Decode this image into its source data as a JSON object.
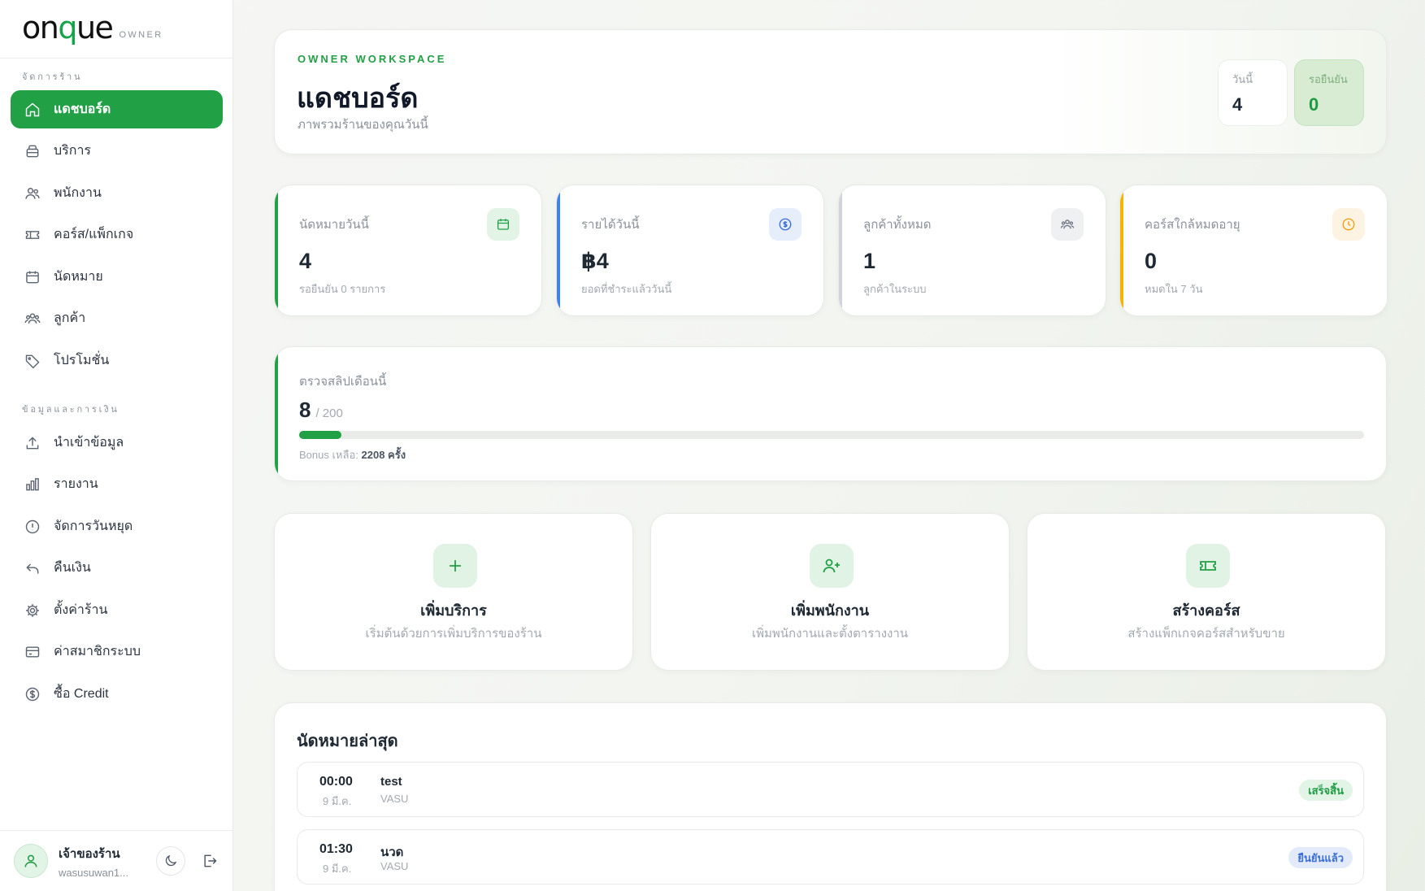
{
  "brand": {
    "logo_pre": "on",
    "logo_q": "q",
    "logo_post": "ue",
    "role": "OWNER"
  },
  "sidebar": {
    "section1": "จัดการร้าน",
    "section2": "ข้อมูลและการเงิน",
    "items": [
      {
        "label": "แดชบอร์ด",
        "icon": "home-icon",
        "active": true
      },
      {
        "label": "บริการ",
        "icon": "box-icon"
      },
      {
        "label": "พนักงาน",
        "icon": "users-icon"
      },
      {
        "label": "คอร์ส/แพ็กเกจ",
        "icon": "ticket-icon"
      },
      {
        "label": "นัดหมาย",
        "icon": "calendar-icon"
      },
      {
        "label": "ลูกค้า",
        "icon": "customers-icon"
      },
      {
        "label": "โปรโมชั่น",
        "icon": "tag-icon"
      },
      {
        "label": "นำเข้าข้อมูล",
        "icon": "upload-icon"
      },
      {
        "label": "รายงาน",
        "icon": "bar-chart-icon"
      },
      {
        "label": "จัดการวันหยุด",
        "icon": "alert-circle-icon"
      },
      {
        "label": "คืนเงิน",
        "icon": "undo-icon"
      },
      {
        "label": "ตั้งค่าร้าน",
        "icon": "gear-icon"
      },
      {
        "label": "ค่าสมาชิกระบบ",
        "icon": "credit-card-icon"
      },
      {
        "label": "ซื้อ Credit",
        "icon": "dollar-icon"
      }
    ]
  },
  "user": {
    "name": "เจ้าของร้าน",
    "email": "wasusuwan1..."
  },
  "hero": {
    "eyebrow": "OWNER WORKSPACE",
    "title": "แดชบอร์ด",
    "subtitle": "ภาพรวมร้านของคุณวันนี้",
    "today_label": "วันนี้",
    "today_value": "4",
    "pending_label": "รอยืนยัน",
    "pending_value": "0"
  },
  "stats": [
    {
      "label": "นัดหมายวันนี้",
      "value": "4",
      "sub": "รอยืนยัน 0 รายการ",
      "icon": "calendar-icon",
      "accent": "#22a045"
    },
    {
      "label": "รายได้วันนี้",
      "value": "฿4",
      "sub": "ยอดที่ชำระแล้ววันนี้",
      "icon": "coin-icon",
      "accent": "#3b82f6"
    },
    {
      "label": "ลูกค้าทั้งหมด",
      "value": "1",
      "sub": "ลูกค้าในระบบ",
      "icon": "group-icon",
      "accent": "#d1d5db"
    },
    {
      "label": "คอร์สใกล้หมดอายุ",
      "value": "0",
      "sub": "หมดใน 7 วัน",
      "icon": "clock-icon",
      "accent": "#f5b400"
    }
  ],
  "quota": {
    "label": "ตรวจสลิปเดือนนี้",
    "used": "8",
    "max": "/ 200",
    "fraction": 0.04,
    "bonus_label": "Bonus เหลือ:",
    "bonus_value": "2208 ครั้ง"
  },
  "actions": [
    {
      "title": "เพิ่มบริการ",
      "sub": "เริ่มต้นด้วยการเพิ่มบริการของร้าน",
      "icon": "plus-icon"
    },
    {
      "title": "เพิ่มพนักงาน",
      "sub": "เพิ่มพนักงานและตั้งตารางงาน",
      "icon": "user-plus-icon"
    },
    {
      "title": "สร้างคอร์ส",
      "sub": "สร้างแพ็กเกจคอร์สสำหรับขาย",
      "icon": "ticket-icon"
    }
  ],
  "recent": {
    "title": "นัดหมายล่าสุด",
    "items": [
      {
        "time": "00:00",
        "date": "9 มี.ค.",
        "service": "test",
        "staff": "VASU",
        "status": "เสร็จสิ้น"
      },
      {
        "time": "01:30",
        "date": "9 มี.ค.",
        "service": "นวด",
        "staff": "VASU",
        "status": "ยืนยันแล้ว"
      }
    ]
  },
  "colors": {
    "primary": "#22a045",
    "blue": "#3b82f6",
    "amber": "#f5b400"
  }
}
